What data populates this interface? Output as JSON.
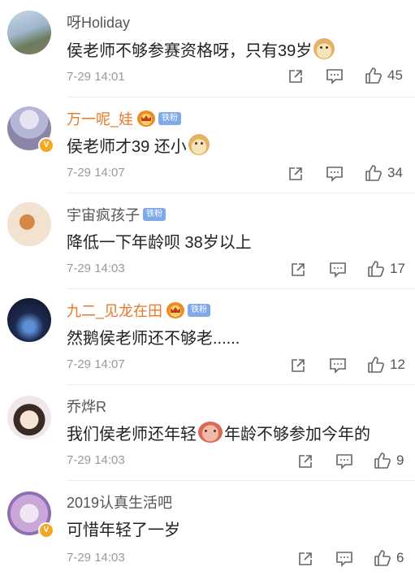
{
  "comments": [
    {
      "username": "呀Holiday",
      "text": "侯老师不够参赛资格呀，只有39岁",
      "time": "7-29 14:01",
      "likes": "45"
    },
    {
      "username": "万一呢_娃",
      "text": "侯老师才39 还小",
      "time": "7-29 14:07",
      "likes": "34",
      "badge": "铁粉"
    },
    {
      "username": "宇宙疯孩子",
      "text": "降低一下年龄呗  38岁以上",
      "time": "7-29 14:03",
      "likes": "17",
      "badge": "铁粉"
    },
    {
      "username": "九二_见龙在田",
      "text": "然鹅侯老师还不够老......",
      "time": "7-29 14:07",
      "likes": "12",
      "badge": "铁粉"
    },
    {
      "username": "乔烨R",
      "text": "我们侯老师还年轻",
      "text_after": "年龄不够参加今年的",
      "time": "7-29 14:03",
      "likes": "9"
    },
    {
      "username": "2019认真生活吧",
      "text": "可惜年轻了一岁",
      "time": "7-29 14:03",
      "likes": "6"
    }
  ],
  "icons": {
    "share": "share-icon",
    "comment": "comment-icon",
    "like": "thumbs-up-icon",
    "verified": "verified-v-icon",
    "vip": "crown-icon",
    "emoji": "doge-emoji-icon"
  },
  "badge_v": "V",
  "colors": {
    "vip_name": "#e8782a",
    "badge_bg": "#7fa9e8",
    "verified": "#f5a623"
  }
}
